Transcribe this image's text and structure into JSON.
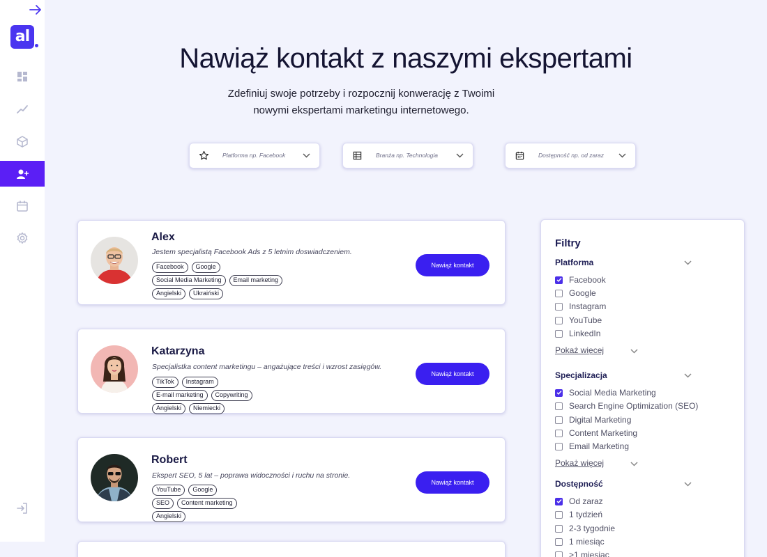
{
  "colors": {
    "accent": "#5b1ff5",
    "button": "#3a1ff0",
    "background": "#f2f3fd",
    "heading": "#141432"
  },
  "sidebar": {
    "logo_text": "al",
    "items": [
      {
        "icon": "dashboard-icon",
        "active": false
      },
      {
        "icon": "trend-chart-icon",
        "active": false
      },
      {
        "icon": "box-icon",
        "active": false
      },
      {
        "icon": "add-user-icon",
        "active": true
      },
      {
        "icon": "calendar-icon",
        "active": false
      },
      {
        "icon": "gear-icon",
        "active": false
      }
    ],
    "bottom_icon": "logout-icon",
    "top_icon": "arrow-right-icon"
  },
  "hero": {
    "title": "Nawiąż kontakt z naszymi ekspertami",
    "subtitle": "Zdefiniuj swoje potrzeby i rozpocznij konwerację z Twoimi nowymi ekspertami marketingu internetowego."
  },
  "dropdowns": [
    {
      "icon": "star-icon",
      "placeholder": "Platforma np. Facebook"
    },
    {
      "icon": "table-icon",
      "placeholder": "Branża np. Technologia"
    },
    {
      "icon": "calendar-icon",
      "placeholder": "Dostępność np. od zaraz"
    }
  ],
  "experts": [
    {
      "name": "Alex",
      "description": "Jestem specjalistą Facebook Ads z 5 letnim doswiadczeniem.",
      "tag_rows": [
        [
          "Facebook",
          "Google"
        ],
        [
          "Social Media Marketing",
          "Email marketing"
        ],
        [
          "Angielski",
          "Ukraiński"
        ]
      ],
      "button": "Nawiąż kontakt"
    },
    {
      "name": "Katarzyna",
      "description": "Specjalistka content marketingu – angażujące treści i wzrost zasięgów.",
      "tag_rows": [
        [
          "TikTok",
          "Instagram"
        ],
        [
          "E-mail marketing",
          "Copywriting"
        ],
        [
          "Angielski",
          "Niemiecki"
        ]
      ],
      "button": "Nawiąż kontakt"
    },
    {
      "name": "Robert",
      "description": "Ekspert SEO, 5 lat – poprawa widoczności i ruchu na stronie.",
      "tag_rows": [
        [
          "YouTube",
          "Google"
        ],
        [
          "SEO",
          "Content marketing"
        ],
        [
          "Angielski"
        ]
      ],
      "button": "Nawiąż kontakt"
    }
  ],
  "filters": {
    "title": "Filtry",
    "sections": [
      {
        "title": "Platforma",
        "options": [
          {
            "label": "Facebook",
            "checked": true
          },
          {
            "label": "Google",
            "checked": false
          },
          {
            "label": "Instagram",
            "checked": false
          },
          {
            "label": "YouTube",
            "checked": false
          },
          {
            "label": "LinkedIn",
            "checked": false
          }
        ],
        "more": "Pokaż więcej"
      },
      {
        "title": "Specjalizacja",
        "options": [
          {
            "label": "Social Media Marketing",
            "checked": true
          },
          {
            "label": "Search Engine Optimization (SEO)",
            "checked": false
          },
          {
            "label": "Digital Marketing",
            "checked": false
          },
          {
            "label": "Content Marketing",
            "checked": false
          },
          {
            "label": "Email Marketing",
            "checked": false
          }
        ],
        "more": "Pokaż więcej"
      },
      {
        "title": "Dostępność",
        "options": [
          {
            "label": "Od zaraz",
            "checked": true
          },
          {
            "label": "1 tydzień",
            "checked": false
          },
          {
            "label": "2-3 tygodnie",
            "checked": false
          },
          {
            "label": "1 miesiąc",
            "checked": false
          },
          {
            "label": ">1 miesiąc",
            "checked": false
          }
        ]
      }
    ]
  }
}
